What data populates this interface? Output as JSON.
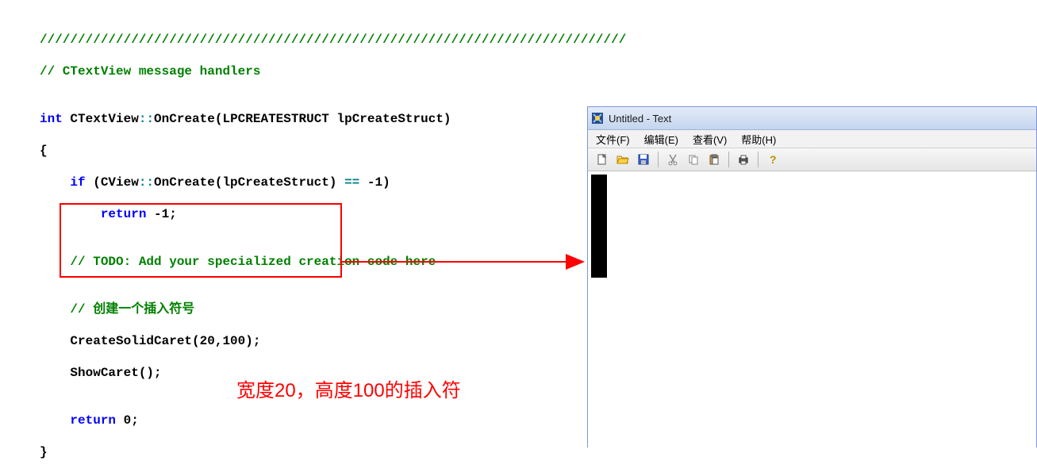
{
  "code": {
    "sep": "/////////////////////////////////////////////////////////////////////////////",
    "handler_comment": "// CTextView message handlers",
    "ret_kw": "int",
    "class": "CTextView",
    "scope_op": "::",
    "method": "OnCreate",
    "param_type": "LPCREATESTRUCT",
    "param_name": "lpCreateStruct",
    "open_brace": "{",
    "if_kw": "if",
    "call1_class": "CView",
    "call1_scope": "::",
    "call1_method": "OnCreate",
    "call1_arg": "lpCreateStruct",
    "eqeq": "==",
    "neg1": "-1",
    "return_kw": "return",
    "ret_neg1": "-1",
    "todo_comment": "// TODO: Add your specialized creation code here",
    "caret_comment": "// 创建一个插入符号",
    "createsolid": "CreateSolidCaret",
    "csc_arg1": "20",
    "csc_arg2": "100",
    "showcaret": "ShowCaret",
    "ret0": "0",
    "close_brace": "}"
  },
  "redbox": {},
  "arrow": {},
  "caption": "宽度20，高度100的插入符",
  "app": {
    "title": "Untitled - Text",
    "menu": {
      "file": "文件(F)",
      "edit": "编辑(E)",
      "view": "查看(V)",
      "help": "帮助(H)"
    },
    "icons": {
      "new": "new-file-icon",
      "open": "open-folder-icon",
      "save": "save-icon",
      "cut": "cut-icon",
      "copy": "copy-icon",
      "paste": "paste-icon",
      "print": "print-icon",
      "help": "help-icon"
    }
  }
}
